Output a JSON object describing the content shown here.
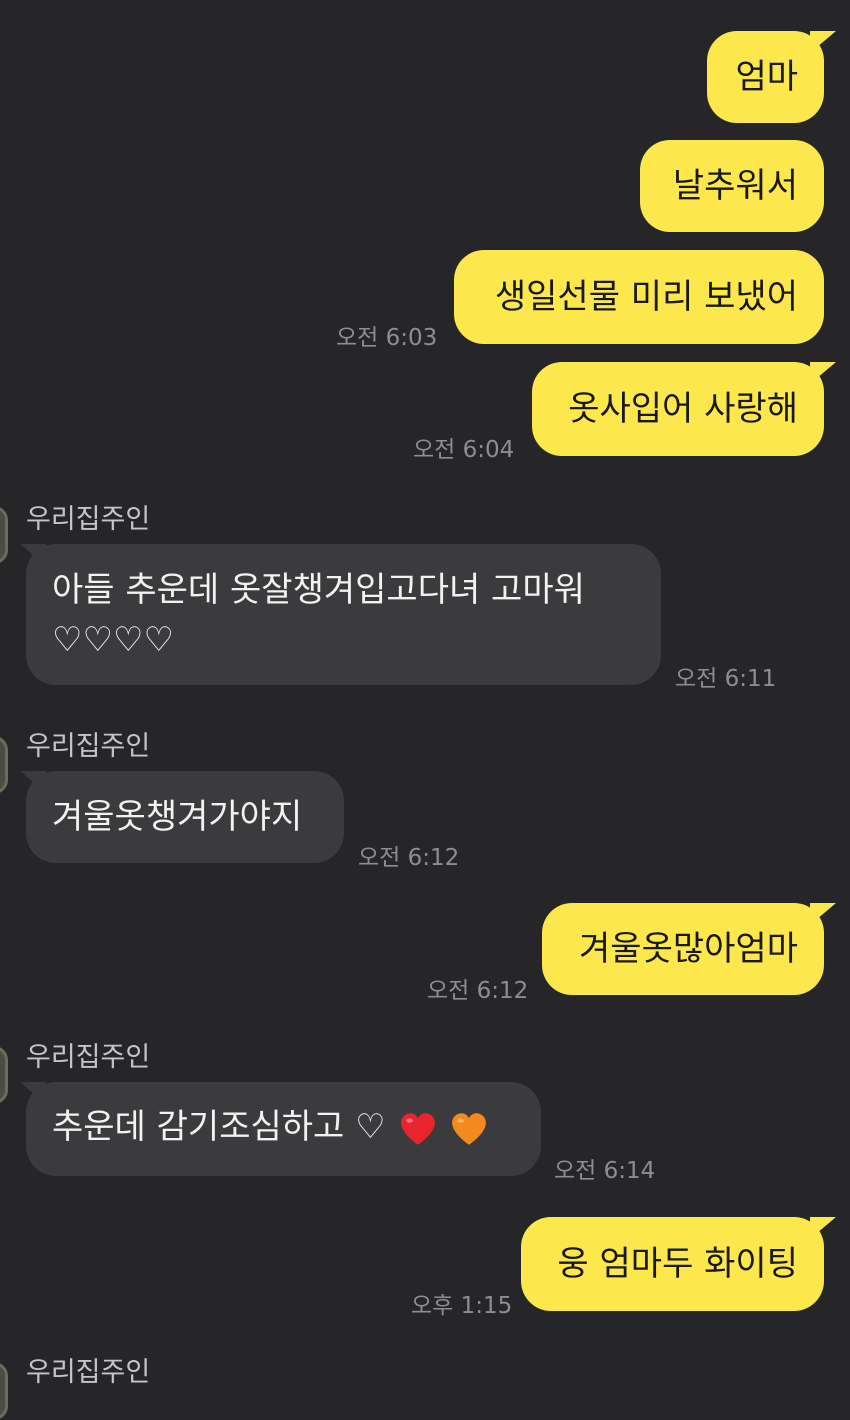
{
  "colors": {
    "background": "#262628",
    "my_bubble": "#FCE84C",
    "their_bubble": "#3B3B3D",
    "timestamp": "#8E8E90"
  },
  "sender_name": "우리집주인",
  "messages": [
    {
      "from": "me",
      "text": "엄마"
    },
    {
      "from": "me",
      "text": "날추워서"
    },
    {
      "from": "me",
      "text": "생일선물 미리 보냈어",
      "time": "오전 6:03"
    },
    {
      "from": "me",
      "text": "옷사입어 사랑해",
      "time": "오전 6:04"
    },
    {
      "from": "them",
      "sender": "우리집주인",
      "line1": "아들 추운데 옷잘챙겨입고다녀 고마워",
      "line2": "♡♡♡♡",
      "time": "오전 6:11"
    },
    {
      "from": "them",
      "sender": "우리집주인",
      "text": "겨울옷챙겨가야지",
      "time": "오전 6:12"
    },
    {
      "from": "me",
      "text": "겨울옷많아엄마",
      "time": "오전 6:12"
    },
    {
      "from": "them",
      "sender": "우리집주인",
      "text": "추운데 감기조심하고 ♡",
      "emoji": [
        "red-heart-icon",
        "orange-heart-icon"
      ],
      "time": "오전 6:14"
    },
    {
      "from": "me",
      "text": "웅 엄마두 화이팅",
      "time": "오후 1:15"
    },
    {
      "from": "them",
      "sender": "우리집주인"
    }
  ]
}
